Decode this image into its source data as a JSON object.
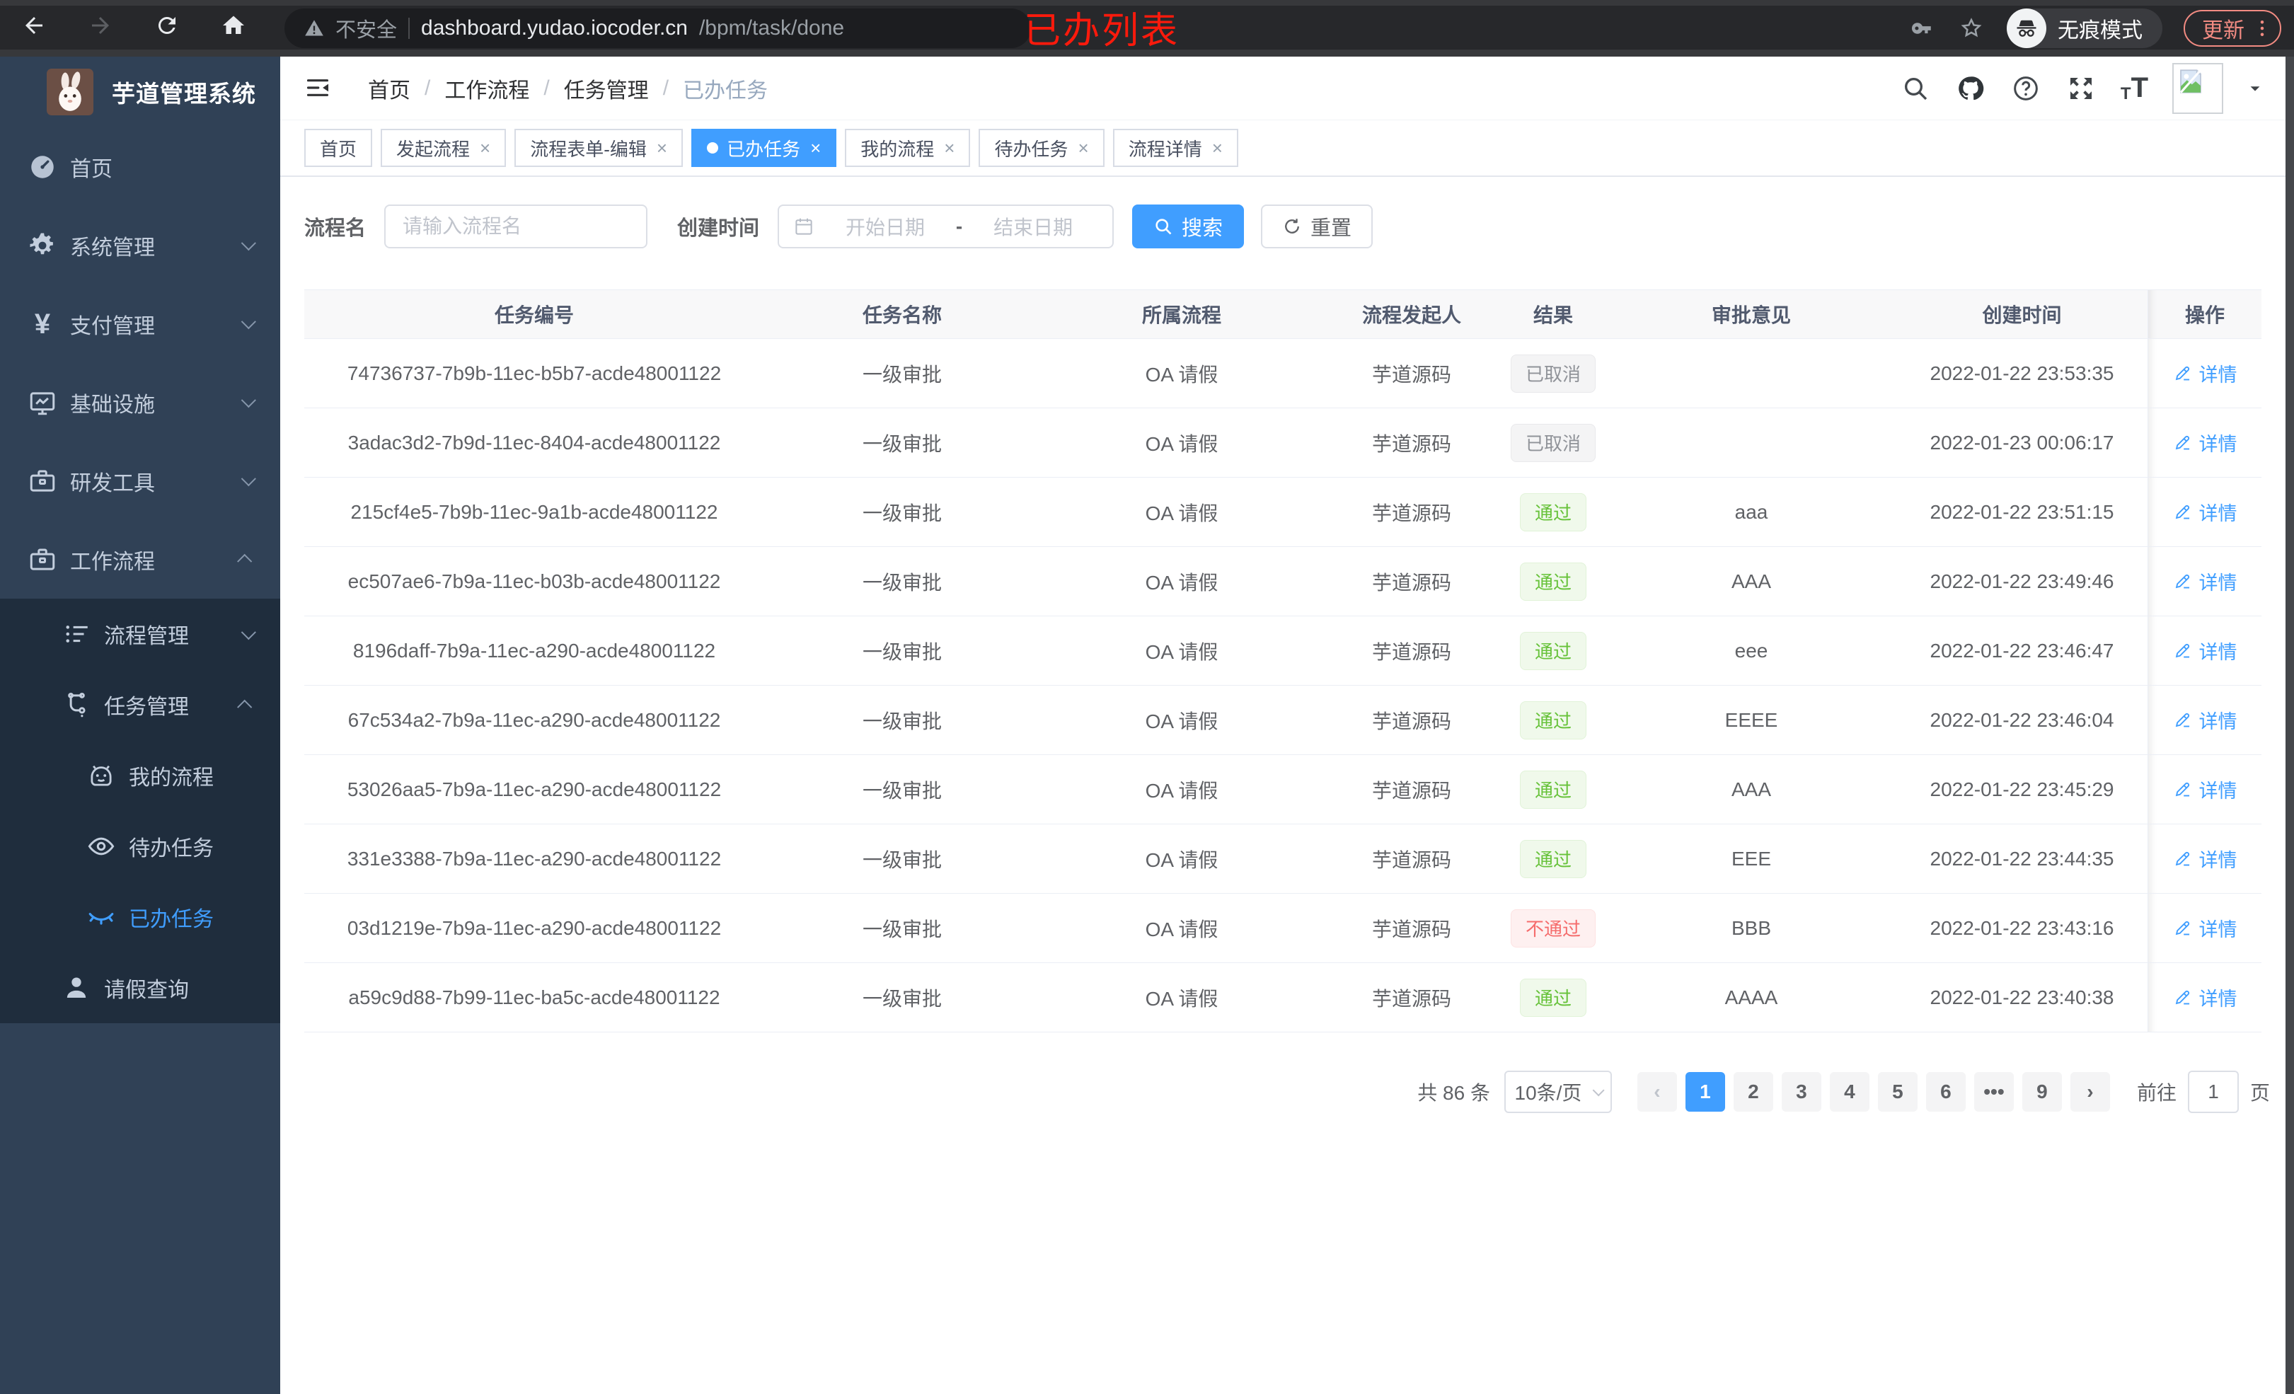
{
  "browser": {
    "security_label": "不安全",
    "url_host": "dashboard.yudao.iocoder.cn",
    "url_path": "/bpm/task/done",
    "overlay_title": "已办列表",
    "incognito_label": "无痕模式",
    "update_label": "更新"
  },
  "sidebar": {
    "app_title": "芋道管理系统",
    "items": [
      {
        "label": "首页",
        "icon": "dashboard-icon",
        "level": 1
      },
      {
        "label": "系统管理",
        "icon": "gear-icon",
        "level": 1,
        "chevron": "down"
      },
      {
        "label": "支付管理",
        "icon": "yen-icon",
        "level": 1,
        "chevron": "down"
      },
      {
        "label": "基础设施",
        "icon": "infra-icon",
        "level": 1,
        "chevron": "down"
      },
      {
        "label": "研发工具",
        "icon": "toolbox-icon",
        "level": 1,
        "chevron": "down"
      },
      {
        "label": "工作流程",
        "icon": "workflow-icon",
        "level": 1,
        "chevron": "up"
      },
      {
        "label": "流程管理",
        "icon": "process-list-icon",
        "level": 2,
        "chevron": "down",
        "dark": true
      },
      {
        "label": "任务管理",
        "icon": "task-tree-icon",
        "level": 2,
        "chevron": "up",
        "dark": true
      },
      {
        "label": "我的流程",
        "icon": "robot-icon",
        "level": 3,
        "dark": true
      },
      {
        "label": "待办任务",
        "icon": "eye-open-icon",
        "level": 3,
        "dark": true
      },
      {
        "label": "已办任务",
        "icon": "eye-closed-icon",
        "level": 3,
        "dark": true,
        "active": true
      },
      {
        "label": "请假查询",
        "icon": "user-icon",
        "level": 2,
        "dark": true
      }
    ]
  },
  "header": {
    "breadcrumb": [
      "首页",
      "工作流程",
      "任务管理",
      "已办任务"
    ]
  },
  "tabs": [
    {
      "label": "首页",
      "closable": false
    },
    {
      "label": "发起流程",
      "closable": true
    },
    {
      "label": "流程表单-编辑",
      "closable": true
    },
    {
      "label": "已办任务",
      "closable": true,
      "active": true
    },
    {
      "label": "我的流程",
      "closable": true
    },
    {
      "label": "待办任务",
      "closable": true
    },
    {
      "label": "流程详情",
      "closable": true
    }
  ],
  "filters": {
    "name_label": "流程名",
    "name_placeholder": "请输入流程名",
    "time_label": "创建时间",
    "start_placeholder": "开始日期",
    "range_separator": "-",
    "end_placeholder": "结束日期",
    "search_label": "搜索",
    "reset_label": "重置"
  },
  "table": {
    "columns": [
      "任务编号",
      "任务名称",
      "所属流程",
      "流程发起人",
      "结果",
      "审批意见",
      "创建时间",
      "操作"
    ],
    "action_label": "详情",
    "rows": [
      {
        "id": "74736737-7b9b-11ec-b5b7-acde48001122",
        "name": "一级审批",
        "flow": "OA 请假",
        "starter": "芋道源码",
        "result": "已取消",
        "result_type": "info",
        "comment": "",
        "created": "2022-01-22 23:53:35"
      },
      {
        "id": "3adac3d2-7b9d-11ec-8404-acde48001122",
        "name": "一级审批",
        "flow": "OA 请假",
        "starter": "芋道源码",
        "result": "已取消",
        "result_type": "info",
        "comment": "",
        "created": "2022-01-23 00:06:17"
      },
      {
        "id": "215cf4e5-7b9b-11ec-9a1b-acde48001122",
        "name": "一级审批",
        "flow": "OA 请假",
        "starter": "芋道源码",
        "result": "通过",
        "result_type": "success",
        "comment": "aaa",
        "created": "2022-01-22 23:51:15"
      },
      {
        "id": "ec507ae6-7b9a-11ec-b03b-acde48001122",
        "name": "一级审批",
        "flow": "OA 请假",
        "starter": "芋道源码",
        "result": "通过",
        "result_type": "success",
        "comment": "AAA",
        "created": "2022-01-22 23:49:46"
      },
      {
        "id": "8196daff-7b9a-11ec-a290-acde48001122",
        "name": "一级审批",
        "flow": "OA 请假",
        "starter": "芋道源码",
        "result": "通过",
        "result_type": "success",
        "comment": "eee",
        "created": "2022-01-22 23:46:47"
      },
      {
        "id": "67c534a2-7b9a-11ec-a290-acde48001122",
        "name": "一级审批",
        "flow": "OA 请假",
        "starter": "芋道源码",
        "result": "通过",
        "result_type": "success",
        "comment": "EEEE",
        "created": "2022-01-22 23:46:04"
      },
      {
        "id": "53026aa5-7b9a-11ec-a290-acde48001122",
        "name": "一级审批",
        "flow": "OA 请假",
        "starter": "芋道源码",
        "result": "通过",
        "result_type": "success",
        "comment": "AAA",
        "created": "2022-01-22 23:45:29"
      },
      {
        "id": "331e3388-7b9a-11ec-a290-acde48001122",
        "name": "一级审批",
        "flow": "OA 请假",
        "starter": "芋道源码",
        "result": "通过",
        "result_type": "success",
        "comment": "EEE",
        "created": "2022-01-22 23:44:35"
      },
      {
        "id": "03d1219e-7b9a-11ec-a290-acde48001122",
        "name": "一级审批",
        "flow": "OA 请假",
        "starter": "芋道源码",
        "result": "不通过",
        "result_type": "danger",
        "comment": "BBB",
        "created": "2022-01-22 23:43:16"
      },
      {
        "id": "a59c9d88-7b99-11ec-ba5c-acde48001122",
        "name": "一级审批",
        "flow": "OA 请假",
        "starter": "芋道源码",
        "result": "通过",
        "result_type": "success",
        "comment": "AAAA",
        "created": "2022-01-22 23:40:38"
      }
    ]
  },
  "pagination": {
    "total": "共 86 条",
    "page_size": "10条/页",
    "prev": "‹",
    "next": "›",
    "pages": [
      "1",
      "2",
      "3",
      "4",
      "5",
      "6",
      "•••",
      "9"
    ],
    "active": "1",
    "goto_label": "前往",
    "goto_value": "1",
    "unit": "页"
  },
  "colors": {
    "accent": "#409eff",
    "success": "#67c23a",
    "danger": "#f56c6c",
    "info": "#909399",
    "overlay": "#fb1a0c",
    "sidebar": "#304156",
    "sidebarDark": "#1f2d3d"
  }
}
